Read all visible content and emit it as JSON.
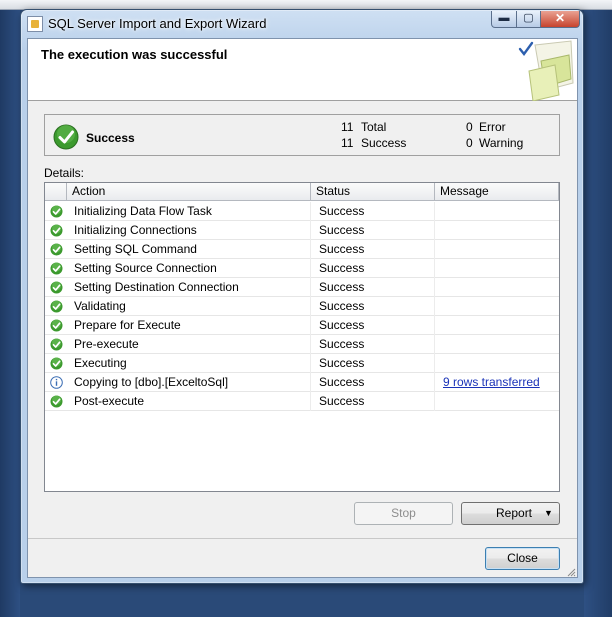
{
  "window": {
    "title": "SQL Server Import and Export Wizard",
    "min_glyph": "▬",
    "max_glyph": "▢",
    "close_glyph": "✕"
  },
  "header": {
    "title": "The execution was successful",
    "art_icon": "wizard-checkmark-icon"
  },
  "summary": {
    "status": "Success",
    "total": "11",
    "total_label": "Total",
    "success": "11",
    "success_label": "Success",
    "error": "0",
    "error_label": "Error",
    "warning": "0",
    "warning_label": "Warning"
  },
  "details": {
    "label": "Details:",
    "columns": {
      "action": "Action",
      "status": "Status",
      "message": "Message"
    },
    "rows": [
      {
        "icon": "success-check-icon",
        "action": "Initializing Data Flow Task",
        "status": "Success",
        "message": ""
      },
      {
        "icon": "success-check-icon",
        "action": "Initializing Connections",
        "status": "Success",
        "message": ""
      },
      {
        "icon": "success-check-icon",
        "action": "Setting SQL Command",
        "status": "Success",
        "message": ""
      },
      {
        "icon": "success-check-icon",
        "action": "Setting Source Connection",
        "status": "Success",
        "message": ""
      },
      {
        "icon": "success-check-icon",
        "action": "Setting Destination Connection",
        "status": "Success",
        "message": ""
      },
      {
        "icon": "success-check-icon",
        "action": "Validating",
        "status": "Success",
        "message": ""
      },
      {
        "icon": "success-check-icon",
        "action": "Prepare for Execute",
        "status": "Success",
        "message": ""
      },
      {
        "icon": "success-check-icon",
        "action": "Pre-execute",
        "status": "Success",
        "message": ""
      },
      {
        "icon": "success-check-icon",
        "action": "Executing",
        "status": "Success",
        "message": ""
      },
      {
        "icon": "info-icon",
        "action": "Copying to [dbo].[ExceltoSql]",
        "status": "Success",
        "message": "9 rows transferred"
      },
      {
        "icon": "success-check-icon",
        "action": "Post-execute",
        "status": "Success",
        "message": ""
      }
    ]
  },
  "buttons": {
    "stop": "Stop",
    "report": "Report",
    "report_arrow": "▼",
    "close": "Close"
  },
  "colors": {
    "success_green": "#3c9a2e",
    "info_blue": "#3c6eb4",
    "link_blue": "#1a33b8"
  }
}
